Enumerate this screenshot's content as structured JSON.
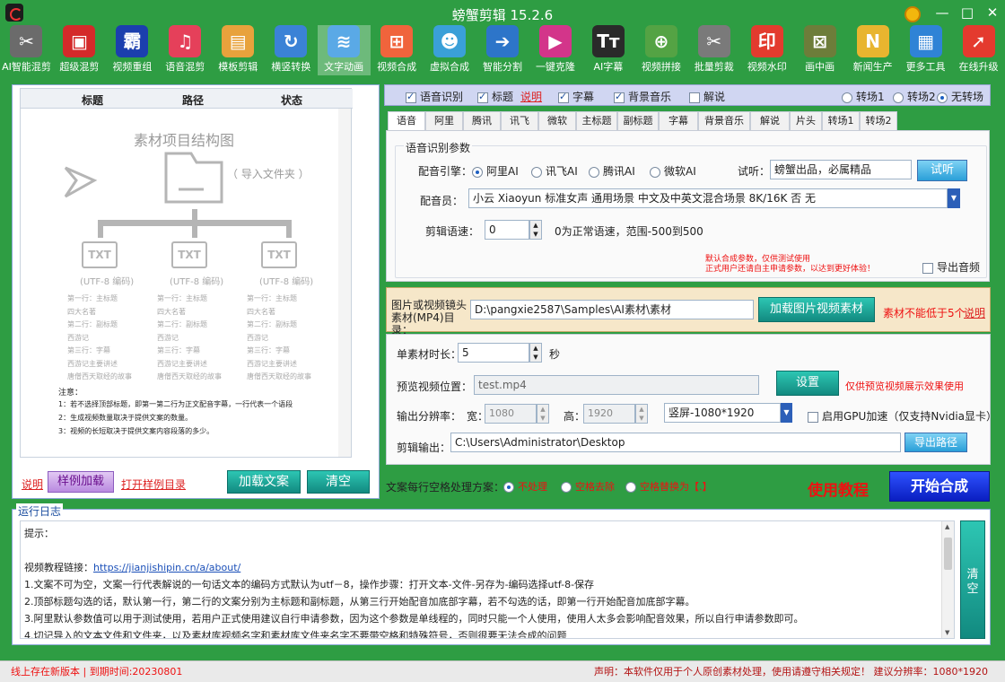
{
  "app": {
    "title": "螃蟹剪辑 15.2.6",
    "win_min": "—",
    "win_max": "□",
    "win_close": "✕"
  },
  "toolbar": [
    {
      "label": "AI智能混剪",
      "icon": "ai-mix-icon",
      "color": "#6b6b6b",
      "glyph": "✂"
    },
    {
      "label": "超级混剪",
      "icon": "super-mix-icon",
      "color": "#d42a2a",
      "glyph": "▣"
    },
    {
      "label": "视频重组",
      "icon": "video-regroup-icon",
      "color": "#1b3fae",
      "glyph": "霸"
    },
    {
      "label": "语音混剪",
      "icon": "voice-mix-icon",
      "color": "#e5405a",
      "glyph": "♫"
    },
    {
      "label": "模板剪辑",
      "icon": "template-edit-icon",
      "color": "#e8a23c",
      "glyph": "▤"
    },
    {
      "label": "横竖转换",
      "icon": "rotate-icon",
      "color": "#3b82d6",
      "glyph": "↻"
    },
    {
      "label": "文字动画",
      "icon": "text-animation-icon",
      "color": "#5aa9e6",
      "glyph": "≋"
    },
    {
      "label": "视频合成",
      "icon": "video-compose-icon",
      "color": "#f0643c",
      "glyph": "⊞"
    },
    {
      "label": "虚拟合成",
      "icon": "virtual-compose-icon",
      "color": "#3aa0d8",
      "glyph": "☻"
    },
    {
      "label": "智能分割",
      "icon": "smart-split-icon",
      "color": "#2d75c9",
      "glyph": "➔"
    },
    {
      "label": "一键克隆",
      "icon": "clone-icon",
      "color": "#d3358a",
      "glyph": "▶"
    },
    {
      "label": "AI字幕",
      "icon": "ai-subtitle-icon",
      "color": "#2a2a2a",
      "glyph": "Tт"
    },
    {
      "label": "视频拼接",
      "icon": "video-join-icon",
      "color": "#54a344",
      "glyph": "⊕"
    },
    {
      "label": "批量剪裁",
      "icon": "batch-crop-icon",
      "color": "#7a7a7a",
      "glyph": "✂"
    },
    {
      "label": "视频水印",
      "icon": "watermark-icon",
      "color": "#e33b2e",
      "glyph": "印"
    },
    {
      "label": "画中画",
      "icon": "pip-icon",
      "color": "#6d7d3a",
      "glyph": "⊠"
    },
    {
      "label": "新闻生产",
      "icon": "news-icon",
      "color": "#e8b52f",
      "glyph": "N"
    },
    {
      "label": "更多工具",
      "icon": "more-tools-icon",
      "color": "#2f83d6",
      "glyph": "▦"
    },
    {
      "label": "在线升级",
      "icon": "upgrade-icon",
      "color": "#e43a2e",
      "glyph": "➚"
    }
  ],
  "left": {
    "headers": [
      "标题",
      "路径",
      "状态"
    ],
    "diagram_title": "素材项目结构图",
    "folder_caption": "（ 导入文件夹 ）",
    "txt_label": "TXT",
    "encoding": "(UTF-8 编码)",
    "sample_lines": [
      "第一行：主标题",
      "四大名著",
      "第二行：副标题",
      "西游记",
      "第三行：字幕",
      "西游记主要讲述",
      "唐僧西天取经的故事"
    ],
    "notes_title": "注意：",
    "notes": [
      "1：若不选择顶部标题，即第一第二行为正文配音字幕，一行代表一个语段",
      "2：生成视频数量取决于提供文案的数量。",
      "3：视频的长短取决于提供文案内容段落的多少。"
    ],
    "explain_link": "说明",
    "sample_load": "样例加载",
    "open_sample": "打开样例目录",
    "load_text": "加载文案",
    "clear": "清空"
  },
  "top_checks": [
    {
      "label": "语音识别",
      "checked": true
    },
    {
      "label": "标题",
      "checked": true
    },
    {
      "label": "字幕",
      "checked": true
    },
    {
      "label": "背景音乐",
      "checked": true
    },
    {
      "label": "解说",
      "checked": false
    }
  ],
  "title_explain": "说明",
  "transitions": [
    {
      "label": "转场1",
      "on": false
    },
    {
      "label": "转场2",
      "on": false
    },
    {
      "label": "无转场",
      "on": true
    }
  ],
  "tabs": [
    "语音",
    "阿里",
    "腾讯",
    "讯飞",
    "微软",
    "主标题",
    "副标题",
    "字幕",
    "背景音乐",
    "解说",
    "片头",
    "转场1",
    "转场2"
  ],
  "speech": {
    "group_title": "语音识别参数",
    "engine_label": "配音引擎：",
    "engines": [
      {
        "label": "阿里AI",
        "on": true
      },
      {
        "label": "讯飞AI",
        "on": false
      },
      {
        "label": "腾讯AI",
        "on": false
      },
      {
        "label": "微软AI",
        "on": false
      }
    ],
    "listen_label": "试听：",
    "listen_value": "螃蟹出品，必属精品",
    "listen_button": "试听",
    "voice_label": "配音员：",
    "voice_value": "小云 Xiaoyun 标准女声 通用场景 中文及中英文混合场景 8K/16K 否 无",
    "speed_label": "剪辑语速：",
    "speed_value": "0",
    "speed_hint": "0为正常语速，范围-500到500",
    "warn1": "默认合成参数，仅供测试使用",
    "warn2": "正式用户还请自主申请参数，以达到更好体验！",
    "export_audio": "导出音频"
  },
  "material": {
    "label": "图片或视频镜头素材(MP4)目录：",
    "path": "D:\\pangxie2587\\Samples\\AI素材\\素材",
    "load_button": "加载图片视频素材",
    "warning": "素材不能低于5个",
    "explain": "说明"
  },
  "settings": {
    "duration_label": "单素材时长：",
    "duration_value": "5",
    "duration_unit": "秒",
    "preview_label": "预览视频位置：",
    "preview_value": "test.mp4",
    "set_button": "设置",
    "preview_note": "仅供预览视频展示效果使用",
    "res_label": "输出分辨率：",
    "width_label": "宽：",
    "width_value": "1080",
    "height_label": "高：",
    "height_value": "1920",
    "orientation": "竖屏-1080*1920",
    "gpu_label": "启用GPU加速（仅支持Nvidia显卡）",
    "output_label": "剪辑输出：",
    "output_value": "C:\\Users\\Administrator\\Desktop",
    "export_path": "导出路径"
  },
  "space_options": {
    "label": "文案每行空格处理方案：",
    "options": [
      {
        "label": "不处理",
        "on": true
      },
      {
        "label": "空格去除",
        "on": false
      },
      {
        "label": "空格替换为【.】",
        "on": false
      }
    ]
  },
  "tutorial": "使用教程",
  "start": "开始合成",
  "log": {
    "title": "运行日志",
    "lines": [
      "提示：",
      "",
      "视频教程链接：",
      "1.文案不可为空，文案一行代表解说的一句话文本的编码方式默认为utf－8，操作步骤：打开文本-文件-另存为-编码选择utf-8-保存",
      "2.顶部标题勾选的话，默认第一行，第二行的文案分别为主标题和副标题，从第三行开始配音加底部字幕，若不勾选的话，即第一行开始配音加底部字幕。",
      "3.阿里默认参数值可以用于测试使用，若用户正式使用建议自行申请参数，因为这个参数是单线程的，同时只能一个人使用，使用人太多会影响配音效果，所以自行申请参数即可。",
      "4.切记导入的文本文件和文件夹，以及素材库视频名字和素材库文件夹名字不要带空格和特殊符号，否则很要无法合成的问题"
    ],
    "url": "https://jianjishipin.cn/a/about/",
    "clear": "清空"
  },
  "status": {
    "left": "线上存在新版本 | 到期时间:20230801",
    "right": "声明：本软件仅用于个人原创素材处理，使用请遵守相关规定！ 建议分辨率：1080*1920"
  }
}
